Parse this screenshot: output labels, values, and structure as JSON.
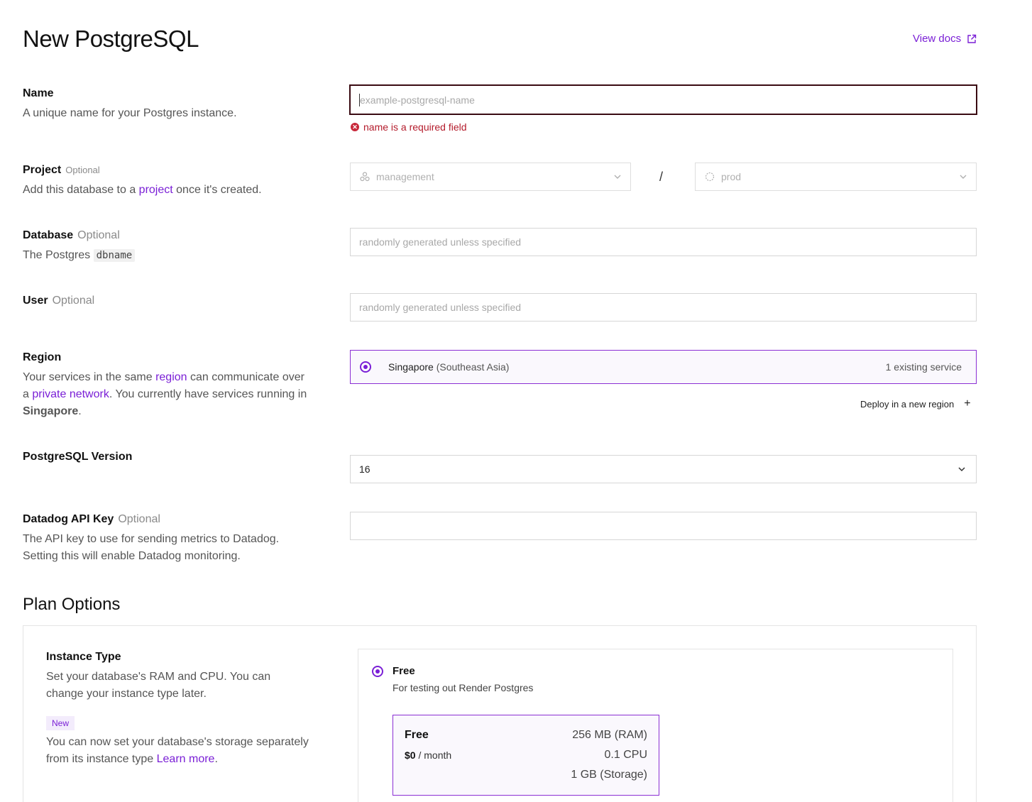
{
  "header": {
    "title": "New PostgreSQL",
    "view_docs": "View docs"
  },
  "name": {
    "label": "Name",
    "description": "A unique name for your Postgres instance.",
    "placeholder": "example-postgresql-name",
    "error": "name is a required field"
  },
  "project": {
    "label": "Project",
    "optional": "Optional",
    "desc_before": "Add this database to a ",
    "desc_link": "project",
    "desc_after": " once it's created.",
    "project_value": "management",
    "environment_value": "prod",
    "separator": "/"
  },
  "database": {
    "label": "Database",
    "optional": "Optional",
    "desc_before": "The Postgres ",
    "desc_code": "dbname",
    "placeholder": "randomly generated unless specified"
  },
  "user": {
    "label": "User",
    "optional": "Optional",
    "placeholder": "randomly generated unless specified"
  },
  "region": {
    "label": "Region",
    "desc_1": "Your services in the same ",
    "desc_link_1": "region",
    "desc_2": " can communicate over a ",
    "desc_link_2": "private network",
    "desc_3": ". You currently have services running in ",
    "desc_strong": "Singapore",
    "desc_4": ".",
    "selected_name": "Singapore",
    "selected_sub": " (Southeast Asia)",
    "existing": "1 existing service",
    "deploy_new": "Deploy in a new region",
    "plus": "+"
  },
  "version": {
    "label": "PostgreSQL Version",
    "value": "16"
  },
  "datadog": {
    "label": "Datadog API Key",
    "optional": "Optional",
    "description": "The API key to use for sending metrics to Datadog. Setting this will enable Datadog monitoring."
  },
  "plan": {
    "section_title": "Plan Options",
    "instance_label": "Instance Type",
    "instance_desc": "Set your database's RAM and CPU. You can change your instance type later.",
    "badge": "New",
    "storage_desc": "You can now set your database's storage separately from its instance type ",
    "learn_more": "Learn more",
    "period": ".",
    "free_title": "Free",
    "free_sub": "For testing out Render Postgres",
    "tile_name": "Free",
    "tile_price": "$0",
    "tile_period": " / month",
    "ram": "256 MB (RAM)",
    "cpu": "0.1 CPU",
    "storage": "1 GB (Storage)"
  },
  "colors": {
    "accent": "#7a1fd6",
    "error": "#b41b2b"
  }
}
